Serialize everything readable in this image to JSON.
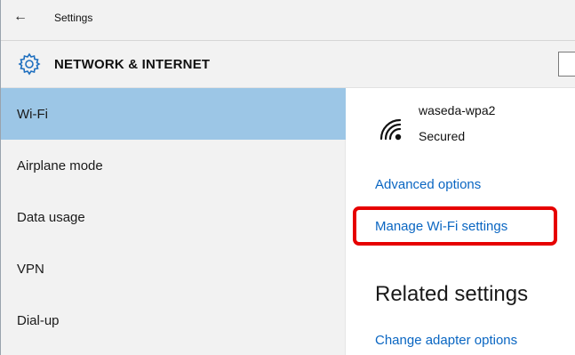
{
  "window": {
    "title": "Settings"
  },
  "header": {
    "title": "NETWORK & INTERNET",
    "icon": "gear-icon"
  },
  "sidebar": {
    "items": [
      {
        "label": "Wi-Fi",
        "selected": true
      },
      {
        "label": "Airplane mode",
        "selected": false
      },
      {
        "label": "Data usage",
        "selected": false
      },
      {
        "label": "VPN",
        "selected": false
      },
      {
        "label": "Dial-up",
        "selected": false
      }
    ]
  },
  "main": {
    "network": {
      "name": "waseda-wpa2",
      "status": "Secured",
      "icon": "wifi-signal-icon"
    },
    "links": {
      "advanced_options": "Advanced options",
      "manage_wifi": "Manage Wi-Fi settings",
      "change_adapter": "Change adapter options"
    },
    "related_heading": "Related settings"
  },
  "colors": {
    "selected_bg": "#9cc6e6",
    "link": "#0a66c2",
    "highlight": "#e60000",
    "panel_bg": "#f2f2f2"
  }
}
